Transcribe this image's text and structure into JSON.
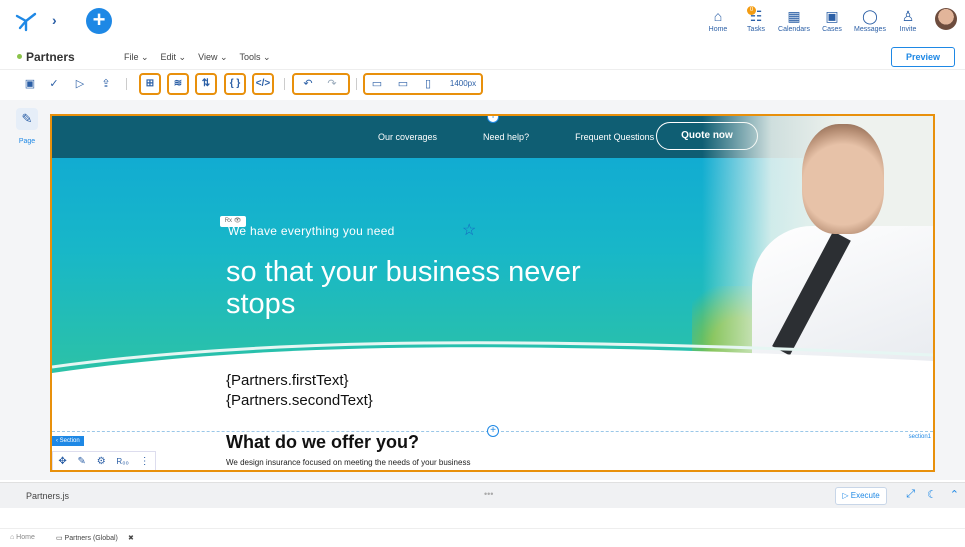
{
  "top": {
    "nav": [
      {
        "label": "Home",
        "icon": "home-icon"
      },
      {
        "label": "Tasks",
        "icon": "tasks-icon",
        "badge": "0"
      },
      {
        "label": "Calendars",
        "icon": "calendar-icon"
      },
      {
        "label": "Cases",
        "icon": "briefcase-icon"
      },
      {
        "label": "Messages",
        "icon": "chat-icon"
      },
      {
        "label": "Invite",
        "icon": "invite-icon"
      }
    ]
  },
  "menubar": {
    "app_name": "Partners",
    "menus": [
      "File ⌄",
      "Edit ⌄",
      "View ⌄",
      "Tools ⌄"
    ],
    "preview": "Preview"
  },
  "toolbar": {
    "width_label": "1400px"
  },
  "leftpanel": {
    "label": "Page"
  },
  "hero": {
    "nav": [
      "Our coverages",
      "Need help?",
      "Frequent Questions"
    ],
    "quote_button": "Quote now",
    "rx_badge": "Rx 👁",
    "subtitle": "We have everything you need",
    "headline": "so that your business never stops"
  },
  "content": {
    "first_text": "{Partners.firstText}",
    "second_text": "{Partners.secondText}",
    "section_tag": "‹ Section",
    "section_right": "section1",
    "offer_title": "What do we offer you?",
    "offer_text": "We design insurance focused on meeting the needs of your business",
    "secbar_r": "R₀₀"
  },
  "bottom": {
    "file": "Partners.js",
    "dots": "•••",
    "execute": "▷ Execute"
  },
  "footer": {
    "home": "⌂ Home",
    "tab": "▭ Partners (Global)",
    "close": "✖"
  },
  "colors": {
    "accent": "#1e88e5",
    "highlight": "#e8900c",
    "nav_band": "#0f5e73"
  }
}
